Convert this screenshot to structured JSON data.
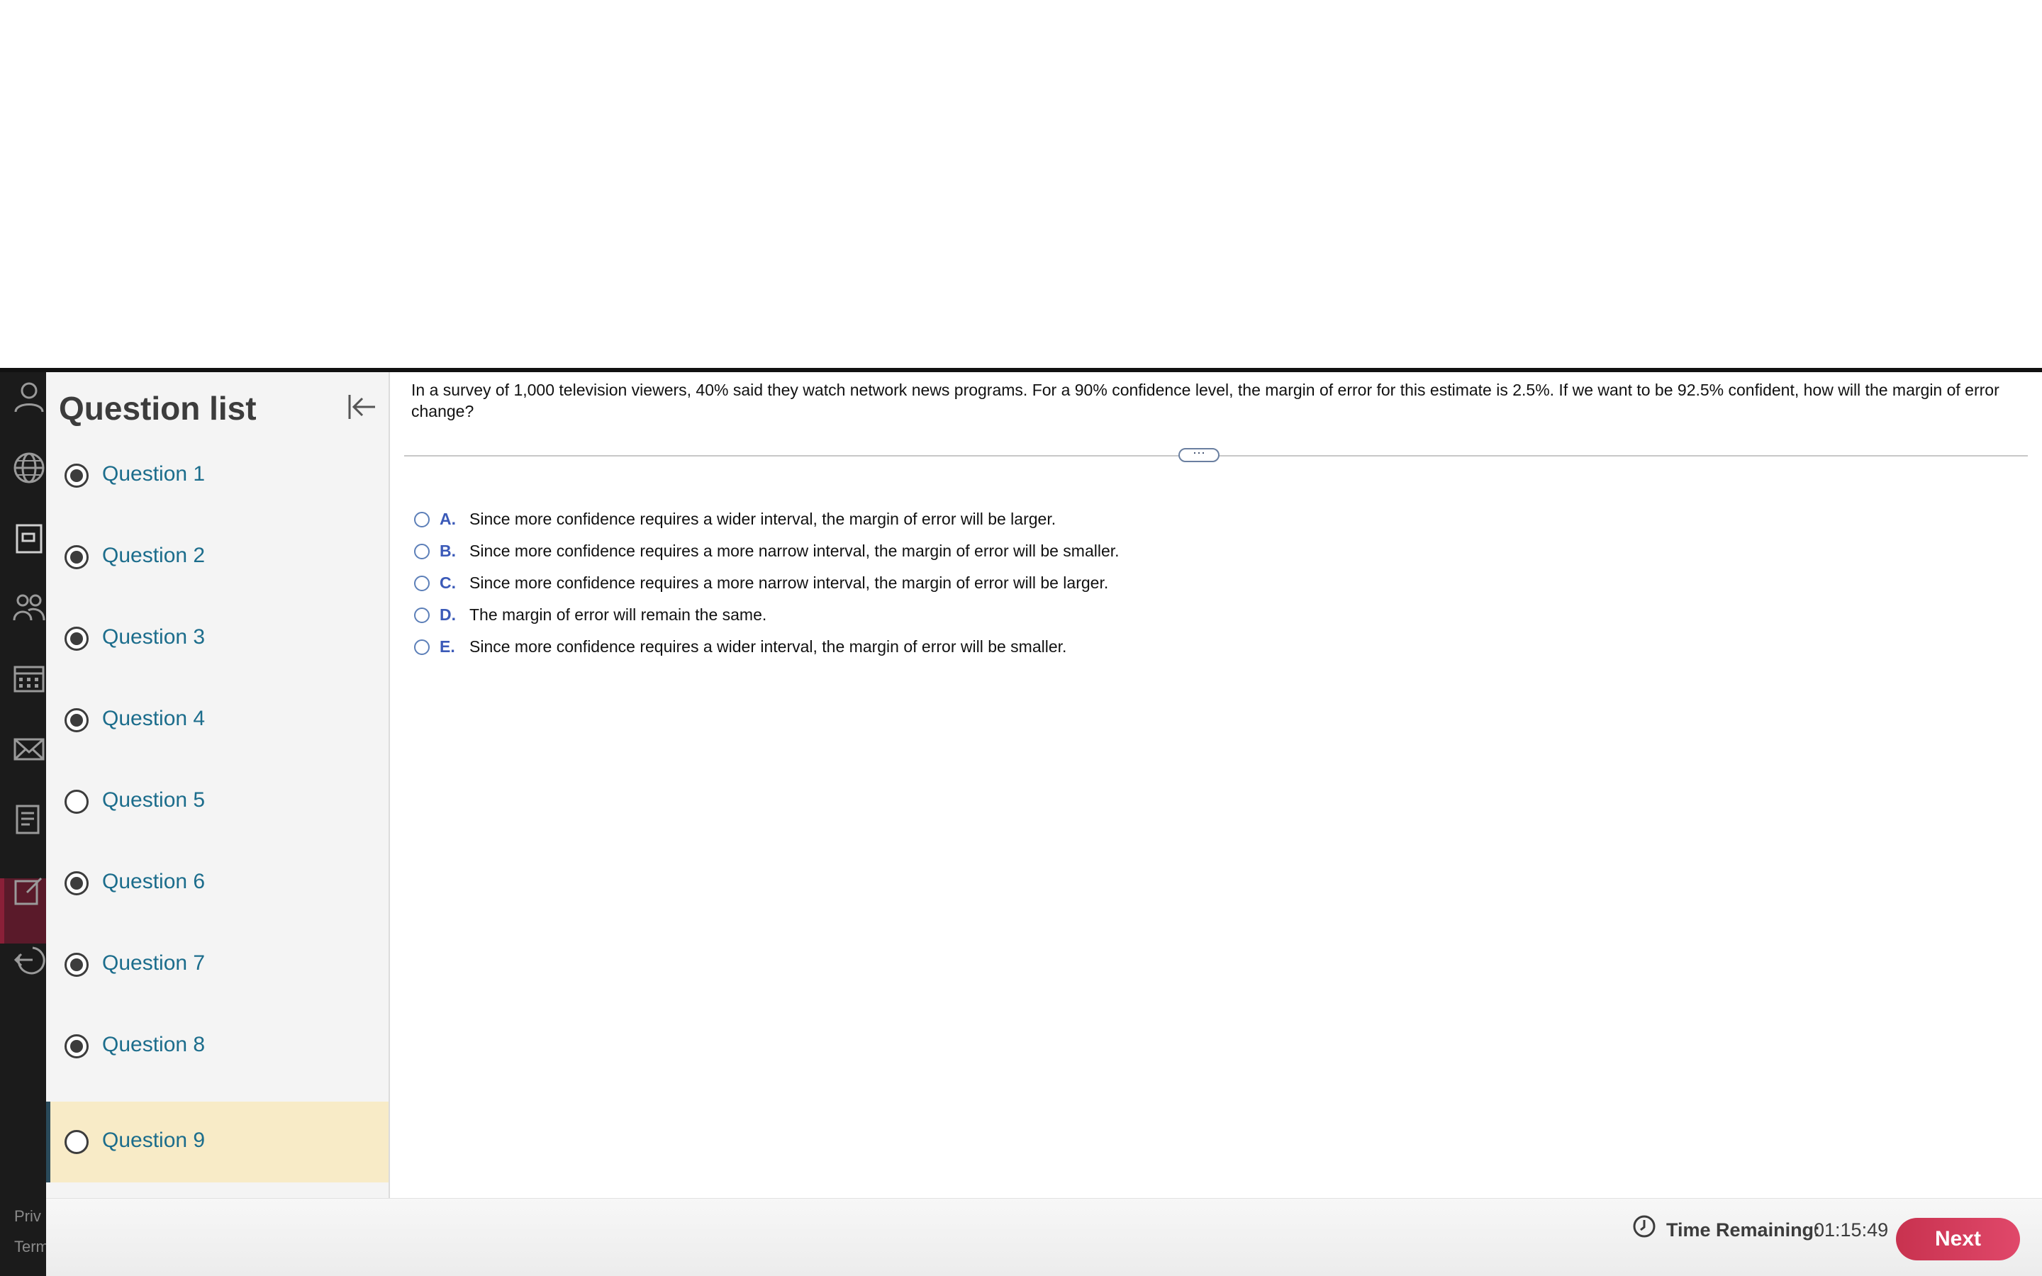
{
  "sidebar": {
    "title": "Question list",
    "footer": [
      "Priv",
      "Term"
    ],
    "questions": [
      {
        "label": "Question 1",
        "answered": true
      },
      {
        "label": "Question 2",
        "answered": true
      },
      {
        "label": "Question 3",
        "answered": true
      },
      {
        "label": "Question 4",
        "answered": true
      },
      {
        "label": "Question 5",
        "answered": false
      },
      {
        "label": "Question 6",
        "answered": true
      },
      {
        "label": "Question 7",
        "answered": true
      },
      {
        "label": "Question 8",
        "answered": true
      },
      {
        "label": "Question 9",
        "answered": false,
        "current": true
      }
    ]
  },
  "rail": {
    "icons": [
      "user-icon",
      "globe-icon",
      "gradebook-icon",
      "people-icon",
      "calendar-icon",
      "mail-icon",
      "document-icon",
      "edit-icon",
      "logout-icon"
    ]
  },
  "question": {
    "text": "In a survey of 1,000 television viewers, 40% said they watch network news programs. For a 90% confidence level, the margin of error for this estimate is 2.5%. If we want to be 92.5% confident, how will the margin of error change?",
    "handle": "⋯",
    "options": [
      {
        "letter": "A.",
        "text": "Since more confidence requires a wider interval, the margin of error will be larger."
      },
      {
        "letter": "B.",
        "text": "Since more confidence requires a more narrow interval, the margin of error will be smaller."
      },
      {
        "letter": "C.",
        "text": "Since more confidence requires a more narrow interval, the margin of error will be larger."
      },
      {
        "letter": "D.",
        "text": "The margin of error will remain the same."
      },
      {
        "letter": "E.",
        "text": "Since more confidence requires a wider interval, the margin of error will be smaller."
      }
    ]
  },
  "footer": {
    "time_label": "Time Remaining:",
    "time_value": "01:15:49",
    "next_label": "Next"
  },
  "colors": {
    "accent": "#d63c5c",
    "link": "#1c6d8c",
    "current_row": "#f8ebc7"
  }
}
